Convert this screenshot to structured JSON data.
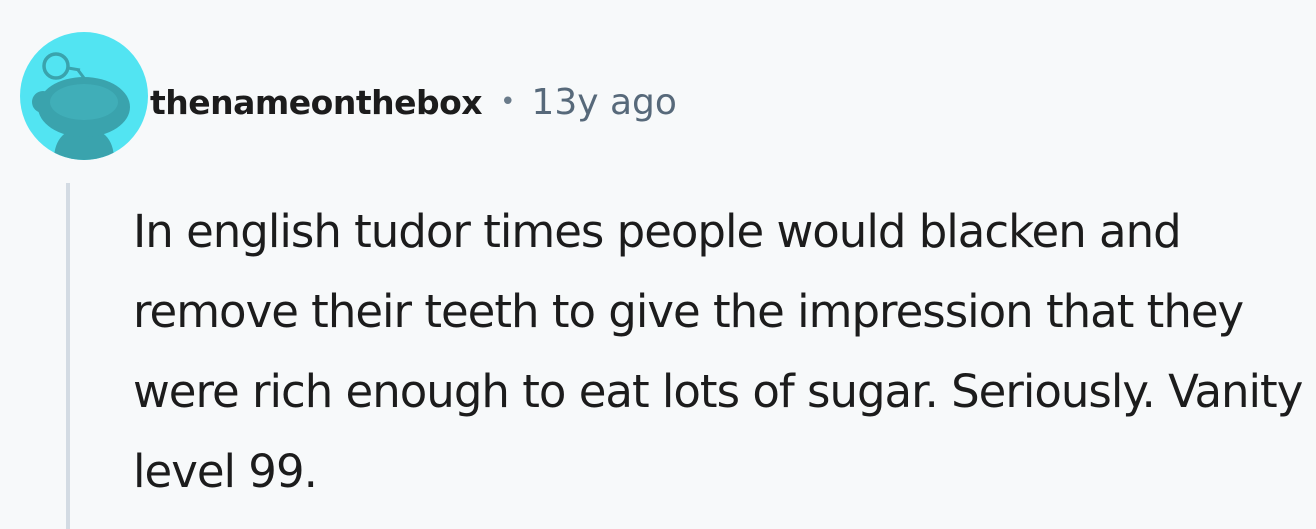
{
  "comment": {
    "author": "thenameonthebox",
    "separator": "•",
    "time_ago": "13y ago",
    "body": "In english tudor times people would blacken and remove their teeth to give the impression that they were rich enough to eat lots of sugar. Seriously. Vanity level 99."
  },
  "colors": {
    "background": "#f7f9fa",
    "avatar_bg": "#52e4f2",
    "avatar_figure": "#3aa3ad",
    "thread_line": "#d3dbe3",
    "meta_text": "#57697a",
    "body_text": "#1c1c1c"
  },
  "icons": {
    "avatar": "reddit-snoo-avatar-icon"
  }
}
